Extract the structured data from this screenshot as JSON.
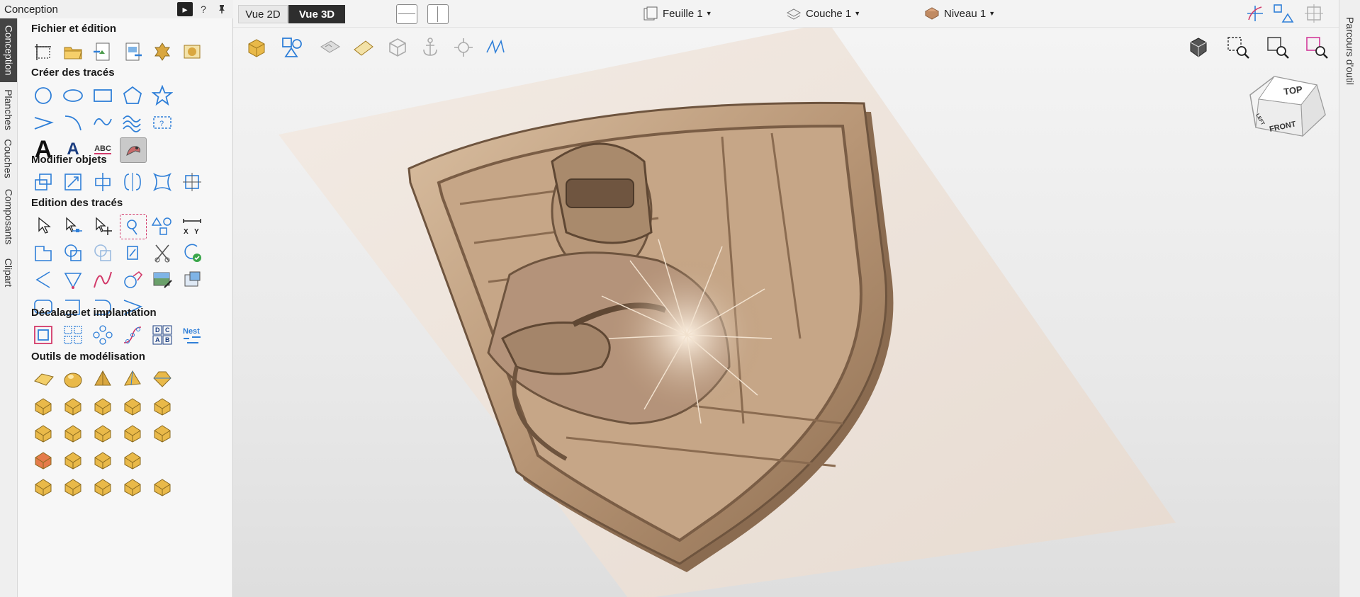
{
  "panel": {
    "title": "Conception",
    "help_label": "?"
  },
  "left_tabs": [
    {
      "label": "Conception"
    },
    {
      "label": "Planches"
    },
    {
      "label": "Couches"
    },
    {
      "label": "Composants"
    },
    {
      "label": "Clipart"
    }
  ],
  "sections": {
    "fichier": "Fichier et édition",
    "creer": "Créer des tracés",
    "modifier": "Modifier objets",
    "edition": "Edition des tracés",
    "decalage": "Décalage et implantation",
    "outils": "Outils de modélisation"
  },
  "tool_text": {
    "text_a": "A",
    "text_abc": "ABC",
    "measure_x": "X",
    "measure_y": "Y",
    "array_letters": [
      "D",
      "C",
      "A",
      "B"
    ],
    "nest_label": "Nest"
  },
  "view_tabs": {
    "vue2d": "Vue 2D",
    "vue3d": "Vue 3D"
  },
  "dropdowns": {
    "feuille": "Feuille 1",
    "couche": "Couche 1",
    "niveau": "Niveau 1"
  },
  "right_tab": {
    "label": "Parcours d'outil"
  },
  "view_cube": {
    "top": "TOP",
    "left": "LEFT",
    "front": "FRONT"
  },
  "colors": {
    "accent_blue": "#2f7fd8",
    "tool_gold": "#d9a740",
    "relief": "#b89878",
    "board": "#eee4dc"
  }
}
